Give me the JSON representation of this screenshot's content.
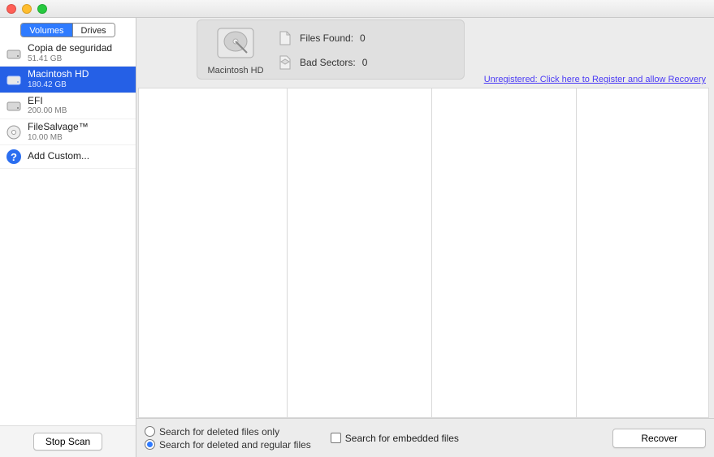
{
  "tabs": {
    "volumes": "Volumes",
    "drives": "Drives",
    "active": "volumes"
  },
  "volumes": [
    {
      "name": "Copia de seguridad",
      "sub": "51.41 GB"
    },
    {
      "name": "Macintosh HD",
      "sub": "180.42 GB"
    },
    {
      "name": "EFI",
      "sub": "200.00 MB"
    },
    {
      "name": "FileSalvage™",
      "sub": "10.00 MB"
    }
  ],
  "add_custom": "Add Custom...",
  "selected_volume_index": 1,
  "info": {
    "drive_label": "Macintosh HD",
    "files_found_label": "Files Found:",
    "files_found_value": "0",
    "bad_sectors_label": "Bad Sectors:",
    "bad_sectors_value": "0"
  },
  "register_link": "Unregistered: Click here to Register and allow Recovery",
  "options": {
    "radio1": "Search for deleted files only",
    "radio2": "Search for deleted and regular files",
    "selected_radio": 2,
    "embedded": "Search for embedded files",
    "embedded_checked": false
  },
  "buttons": {
    "stop_scan": "Stop Scan",
    "recover": "Recover"
  }
}
